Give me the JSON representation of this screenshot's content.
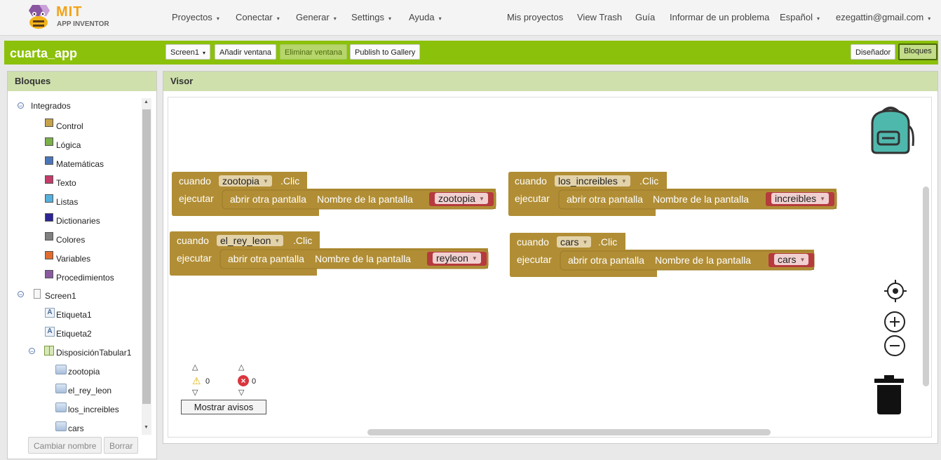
{
  "nav": {
    "logo_top": "MIT",
    "logo_bottom": "APP INVENTOR",
    "menus": [
      "Proyectos",
      "Conectar",
      "Generar",
      "Settings",
      "Ayuda"
    ],
    "links": [
      "Mis proyectos",
      "View Trash",
      "Guía",
      "Informar de un problema"
    ],
    "language": "Español",
    "user": "ezegattin@gmail.com"
  },
  "toolbar": {
    "project": "cuarta_app",
    "screen": "Screen1",
    "add_screen": "Añadir ventana",
    "remove_screen": "Eliminar ventana",
    "publish": "Publish to Gallery",
    "designer": "Diseñador",
    "blocks": "Bloques"
  },
  "blocks_panel": {
    "title": "Bloques",
    "builtin": "Integrados",
    "builtin_items": [
      {
        "label": "Control",
        "color": "#c6a24a"
      },
      {
        "label": "Lógica",
        "color": "#7bb04a"
      },
      {
        "label": "Matemáticas",
        "color": "#4a76b8"
      },
      {
        "label": "Texto",
        "color": "#c43c6a"
      },
      {
        "label": "Listas",
        "color": "#55b0dc"
      },
      {
        "label": "Dictionaries",
        "color": "#2d2596"
      },
      {
        "label": "Colores",
        "color": "#808080"
      },
      {
        "label": "Variables",
        "color": "#e06b2d"
      },
      {
        "label": "Procedimientos",
        "color": "#8a5aa0"
      }
    ],
    "screen": "Screen1",
    "components": [
      "Etiqueta1",
      "Etiqueta2"
    ],
    "table": "DisposiciónTabular1",
    "table_children": [
      "zootopia",
      "el_rey_leon",
      "los_increibles",
      "cars"
    ],
    "rename": "Cambiar nombre",
    "delete": "Borrar"
  },
  "viewer": {
    "title": "Visor",
    "warnings": "0",
    "errors": "0",
    "show_warnings": "Mostrar avisos"
  },
  "code_blocks": [
    {
      "when": "cuando",
      "component": "zootopia",
      "event": ".Clic",
      "do": "ejecutar",
      "action": "abrir otra pantalla",
      "param": "Nombre de la pantalla",
      "value": "zootopia"
    },
    {
      "when": "cuando",
      "component": "los_increibles",
      "event": ".Clic",
      "do": "ejecutar",
      "action": "abrir otra pantalla",
      "param": "Nombre de la pantalla",
      "value": "increibles"
    },
    {
      "when": "cuando",
      "component": "el_rey_leon",
      "event": ".Clic",
      "do": "ejecutar",
      "action": "abrir otra pantalla",
      "param": "Nombre de la pantalla",
      "value": "reyleon"
    },
    {
      "when": "cuando",
      "component": "cars",
      "event": ".Clic",
      "do": "ejecutar",
      "action": "abrir otra pantalla",
      "param": "Nombre de la pantalla",
      "value": "cars"
    }
  ],
  "colors": {
    "accent": "#8bc10a",
    "event_block": "#b18e35",
    "string_block": "#b53b3e"
  }
}
